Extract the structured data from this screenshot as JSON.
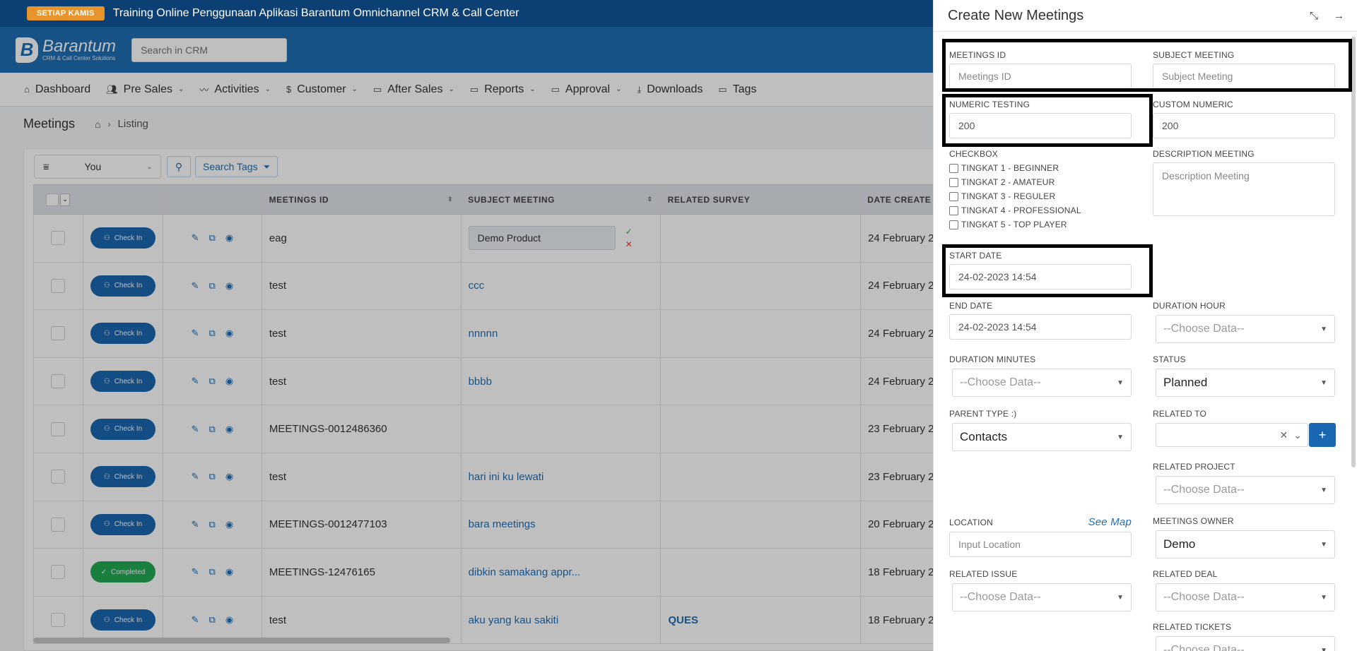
{
  "banner": {
    "badge": "SETIAP KAMIS",
    "text": "Training Online Penggunaan Aplikasi Barantum Omnichannel CRM & Call Center"
  },
  "header": {
    "logo_name": "Barantum",
    "logo_sub": "CRM & Call Center Solutions",
    "search_placeholder": "Search in CRM"
  },
  "nav": [
    {
      "label": "Dashboard",
      "icon": "home-icon",
      "has_menu": false
    },
    {
      "label": "Pre Sales",
      "icon": "users-icon",
      "has_menu": true
    },
    {
      "label": "Activities",
      "icon": "activity-icon",
      "has_menu": true
    },
    {
      "label": "Customer",
      "icon": "dollar-icon",
      "has_menu": true
    },
    {
      "label": "After Sales",
      "icon": "folder-icon",
      "has_menu": true
    },
    {
      "label": "Reports",
      "icon": "folder-icon",
      "has_menu": true
    },
    {
      "label": "Approval",
      "icon": "folder-icon",
      "has_menu": true
    },
    {
      "label": "Downloads",
      "icon": "download-icon",
      "has_menu": false
    },
    {
      "label": "Tags",
      "icon": "folder-icon",
      "has_menu": false
    }
  ],
  "breadcrumb": {
    "title": "Meetings",
    "current": "Listing"
  },
  "toolbar": {
    "filter_value": "You",
    "tags_label": "Search Tags"
  },
  "table": {
    "headers": {
      "meetings_id": "MEETINGS ID",
      "subject": "SUBJECT MEETING",
      "survey": "RELATED SURVEY",
      "date": "DATE CREATE"
    },
    "rows": [
      {
        "status": "Check In",
        "id": "eag",
        "subject": "Demo Product",
        "survey": "",
        "date": "24 February 2",
        "editing": true
      },
      {
        "status": "Check In",
        "id": "test",
        "subject": "ccc",
        "survey": "",
        "date": "24 February 2"
      },
      {
        "status": "Check In",
        "id": "test",
        "subject": "nnnnn",
        "survey": "",
        "date": "24 February 2"
      },
      {
        "status": "Check In",
        "id": "test",
        "subject": "bbbb",
        "survey": "",
        "date": "24 February 2"
      },
      {
        "status": "Check In",
        "id": "MEETINGS-0012486360",
        "subject": "",
        "survey": "",
        "date": "23 February 2"
      },
      {
        "status": "Check In",
        "id": "test",
        "subject": "hari ini ku lewati",
        "survey": "",
        "date": "23 February 2"
      },
      {
        "status": "Check In",
        "id": "MEETINGS-0012477103",
        "subject": "bara meetings",
        "survey": "",
        "date": "20 February 2"
      },
      {
        "status": "Completed",
        "id": "MEETINGS-12476165",
        "subject": "dibkin samakang appr...",
        "survey": "",
        "date": "18 February 2"
      },
      {
        "status": "Check In",
        "id": "test",
        "subject": "aku yang kau sakiti",
        "survey": "QUES",
        "date": "18 February 2"
      }
    ]
  },
  "panel": {
    "title": "Create New Meetings",
    "meetings_id": {
      "label": "MEETINGS ID",
      "placeholder": "Meetings ID"
    },
    "subject": {
      "label": "SUBJECT MEETING",
      "placeholder": "Subject Meeting"
    },
    "numeric_testing": {
      "label": "NUMERIC TESTING",
      "value": "200"
    },
    "custom_numeric": {
      "label": "CUSTOM NUMERIC",
      "value": "200"
    },
    "checkbox": {
      "label": "CHECKBOX",
      "options": [
        "TINGKAT 1 - BEGINNER",
        "TINGKAT 2 - AMATEUR",
        "TINGKAT 3 - REGULER",
        "TINGKAT 4 - PROFESSIONAL",
        "TINGKAT 5 - TOP PLAYER"
      ]
    },
    "description": {
      "label": "DESCRIPTION MEETING",
      "placeholder": "Description Meeting"
    },
    "start_date": {
      "label": "START DATE",
      "value": "24-02-2023 14:54"
    },
    "end_date": {
      "label": "END DATE",
      "value": "24-02-2023 14:54"
    },
    "duration_hour": {
      "label": "DURATION HOUR",
      "value": "--Choose Data--"
    },
    "duration_minutes": {
      "label": "DURATION MINUTES",
      "value": "--Choose Data--"
    },
    "status": {
      "label": "STATUS",
      "value": "Planned"
    },
    "parent_type": {
      "label": "PARENT TYPE :)",
      "value": "Contacts"
    },
    "related_to": {
      "label": "RELATED TO",
      "value": ""
    },
    "related_project": {
      "label": "RELATED PROJECT",
      "value": "--Choose Data--"
    },
    "location": {
      "label": "LOCATION",
      "see_map": "See Map",
      "placeholder": "Input Location"
    },
    "meetings_owner": {
      "label": "MEETINGS OWNER",
      "value": "Demo"
    },
    "related_issue": {
      "label": "RELATED ISSUE",
      "value": "--Choose Data--"
    },
    "related_deal": {
      "label": "RELATED DEAL",
      "value": "--Choose Data--"
    },
    "related_tickets": {
      "label": "RELATED TICKETS",
      "value": "--Choose Data--"
    }
  },
  "colors": {
    "primary": "#1f6fb4",
    "banner": "#0c3f73",
    "badge": "#e8942c",
    "completed": "#23a855"
  }
}
